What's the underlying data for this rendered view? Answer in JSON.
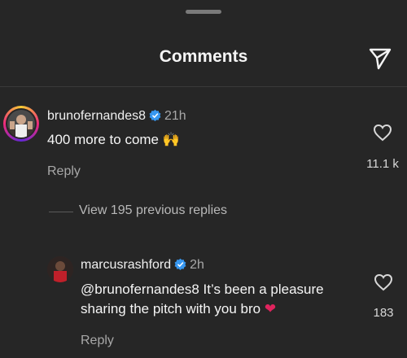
{
  "header": {
    "title": "Comments"
  },
  "comment": {
    "username": "brunofernandes8",
    "time": "21h",
    "text": "400 more to come 🙌",
    "reply_label": "Reply",
    "likes": "11.1 k"
  },
  "view_replies": "View 195 previous replies",
  "reply": {
    "username": "marcusrashford",
    "time": "2h",
    "text_line1": "@brunofernandes8 It’s been a pleasure",
    "text_line2": "sharing the pitch with you bro",
    "reply_label": "Reply",
    "likes": "183"
  },
  "colors": {
    "background": "#262626",
    "verified": "#3797f0",
    "heart_emoji": "#e0245e"
  }
}
